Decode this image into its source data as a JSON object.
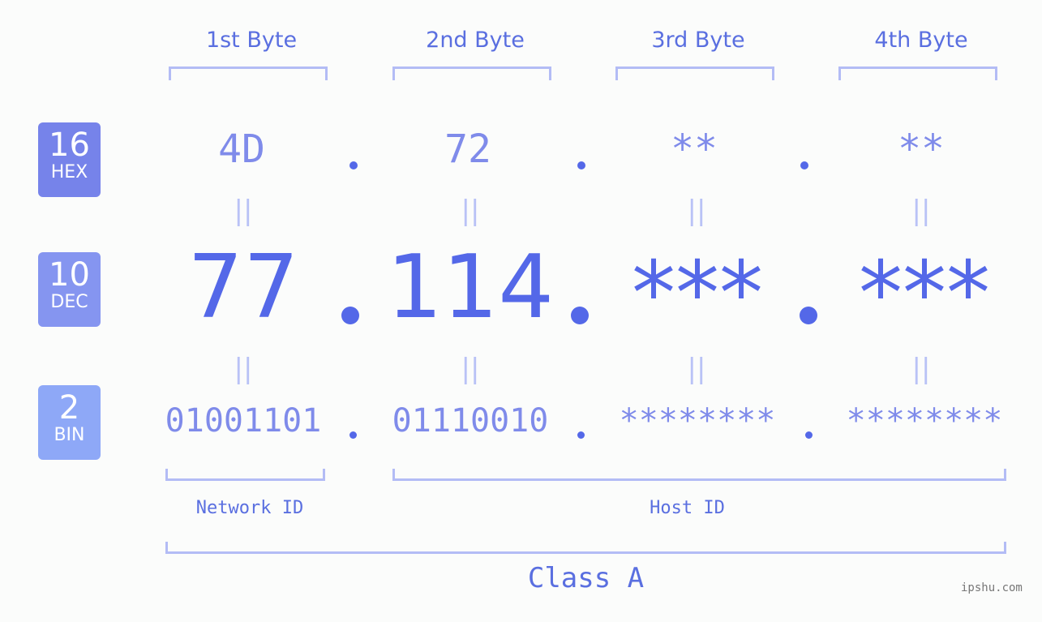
{
  "bytes": [
    {
      "label": "1st Byte",
      "hex": "4D",
      "dec": "77",
      "bin": "01001101"
    },
    {
      "label": "2nd Byte",
      "hex": "72",
      "dec": "114",
      "bin": "01110010"
    },
    {
      "label": "3rd Byte",
      "hex": "**",
      "dec": "***",
      "bin": "********"
    },
    {
      "label": "4th Byte",
      "hex": "**",
      "dec": "***",
      "bin": "********"
    }
  ],
  "bases": {
    "hex": {
      "num": "16",
      "name": "HEX",
      "color": "#7683ea"
    },
    "dec": {
      "num": "10",
      "name": "DEC",
      "color": "#8595f0"
    },
    "bin": {
      "num": "2",
      "name": "BIN",
      "color": "#8ea8f7"
    }
  },
  "equals": "||",
  "network_id_label": "Network ID",
  "host_id_label": "Host ID",
  "class_label": "Class A",
  "watermark": "ipshu.com",
  "colors": {
    "accent": "#5468e8",
    "light": "#7f8bea",
    "bracket": "#b3bcf5"
  }
}
